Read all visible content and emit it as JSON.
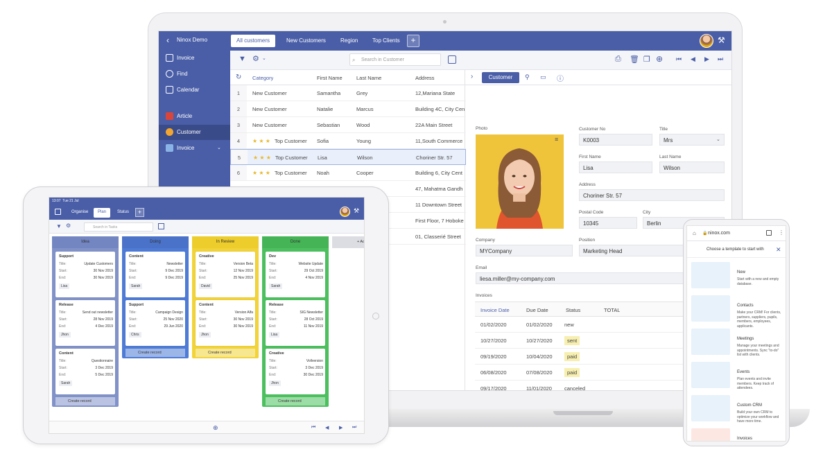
{
  "laptop": {
    "app_name": "Ninox Demo",
    "tabs": [
      "All customers",
      "New Customers",
      "Region",
      "Top Clients"
    ],
    "tab_plus": "+",
    "sidebar": [
      {
        "label": "Invoice",
        "icon": "grid-icon"
      },
      {
        "label": "Find",
        "icon": "search-icon"
      },
      {
        "label": "Calendar",
        "icon": "calendar-icon"
      },
      {
        "label": "Article",
        "icon": "gift-icon"
      },
      {
        "label": "Customer",
        "icon": "people-icon"
      },
      {
        "label": "Invoice",
        "icon": "invoice-icon"
      }
    ],
    "search_placeholder": "Search in Customer",
    "columns": [
      "Category",
      "First Name",
      "Last Name",
      "Address"
    ],
    "rows": [
      {
        "n": "1",
        "stars": "",
        "category": "New Customer",
        "first": "Samantha",
        "last": "Grey",
        "address": "12,Mariana State"
      },
      {
        "n": "2",
        "stars": "",
        "category": "New Customer",
        "first": "Natalie",
        "last": "Marcus",
        "address": "Building 4C, City Cen"
      },
      {
        "n": "3",
        "stars": "",
        "category": "New Customer",
        "first": "Sebastian",
        "last": "Wood",
        "address": "22A Main Street"
      },
      {
        "n": "4",
        "stars": "★ ★ ★",
        "category": "Top Customer",
        "first": "Sofia",
        "last": "Young",
        "address": "11,South Commerce"
      },
      {
        "n": "5",
        "stars": "★ ★ ★",
        "category": "Top Customer",
        "first": "Lisa",
        "last": "Wilson",
        "address": "Choriner Str. 57"
      },
      {
        "n": "6",
        "stars": "★ ★ ★",
        "category": "Top Customer",
        "first": "Noah",
        "last": "Cooper",
        "address": "Building 6, City Cent"
      }
    ],
    "extra_addresses": [
      "47, Mahatma Gandh",
      "11 Downtown Street",
      "First Floor, 7 Hoboke",
      "01, Classerié Street"
    ],
    "detail": {
      "tab": "Customer",
      "photo_label": "Photo",
      "customer_no_label": "Customer No",
      "customer_no": "K0003",
      "title_label": "Title",
      "title": "Mrs",
      "first_name_label": "First Name",
      "first_name": "Lisa",
      "last_name_label": "Last Name",
      "last_name": "Wilson",
      "address_label": "Address",
      "address": "Choriner Str. 57",
      "postal_label": "Postal Code",
      "postal": "10345",
      "city_label": "City",
      "city": "Berlin",
      "company_label": "Company",
      "company": "MYCompany",
      "position_label": "Position",
      "position": "Marketing Head",
      "email_label": "Email",
      "email": "liesa.miller@my-company.com",
      "invoices_label": "Invoices",
      "inv_columns": [
        "Invoice Date",
        "Due Date",
        "Status",
        "TOTAL"
      ],
      "invoices": [
        {
          "date": "01/02/2020",
          "due": "01/02/2020",
          "status": "new",
          "badge": ""
        },
        {
          "date": "10/27/2020",
          "due": "10/27/2020",
          "status": "sent",
          "badge": "#f7efb0"
        },
        {
          "date": "09/19/2020",
          "due": "10/04/2020",
          "status": "paid",
          "badge": "#f7efb0"
        },
        {
          "date": "06/08/2020",
          "due": "07/08/2020",
          "status": "paid",
          "badge": "#f7efb0"
        },
        {
          "date": "09/17/2020",
          "due": "11/01/2020",
          "status": "canceled",
          "badge": ""
        }
      ]
    }
  },
  "tablet": {
    "status_time": "13:07",
    "status_date": "Tue 21 Jul",
    "tabs": [
      "Organise",
      "Plan",
      "Status"
    ],
    "tab_plus": "+",
    "search_placeholder": "Search in Tasks",
    "columns": [
      {
        "name": "Idea",
        "color": "#8192c8",
        "head": "#7386c2",
        "cards": [
          {
            "type": "Support",
            "title": "Update Customers",
            "start": "30 Nov 2019",
            "end": "30 Nov 2019",
            "who": "Lisa"
          },
          {
            "type": "Release",
            "title": "Send out newsletter",
            "start": "28 Nov 2019",
            "end": "4 Dec 2019",
            "who": "Jhon"
          },
          {
            "type": "Content",
            "title": "Questionnaire",
            "start": "3 Dec 2019",
            "end": "5 Dec 2019",
            "who": "Sarah"
          }
        ],
        "create": "Create record"
      },
      {
        "name": "Doing",
        "color": "#4e7bd6",
        "head": "#4a72c8",
        "cards": [
          {
            "type": "Content",
            "title": "Newsletter",
            "start": "9 Dec 2019",
            "end": "9 Dec 2019",
            "who": "Sarah"
          },
          {
            "type": "Support",
            "title": "Campaign Design",
            "start": "25 Nov 2020",
            "end": "29 Jun 2020",
            "who": "Chris"
          }
        ],
        "create": "Create record"
      },
      {
        "name": "In Review",
        "color": "#f2d338",
        "head": "#edcd2c",
        "cards": [
          {
            "type": "Creative",
            "title": "Version Beta",
            "start": "12 Nov 2019",
            "end": "25 Nov 2019",
            "who": "David"
          },
          {
            "type": "Content",
            "title": "Version Alfa",
            "start": "30 Nov 2019",
            "end": "30 Nov 2019",
            "who": "Jhon"
          }
        ],
        "create": "Create record"
      },
      {
        "name": "Done",
        "color": "#4cc05e",
        "head": "#45b456",
        "cards": [
          {
            "type": "Dev",
            "title": "Website Update",
            "start": "29 Oct 2019",
            "end": "4 Nov 2019",
            "who": "Sarah"
          },
          {
            "type": "Release",
            "title": "SIG Newsletter",
            "start": "28 Oct 2019",
            "end": "11 Nov 2019",
            "who": "Lisa"
          },
          {
            "type": "Creative",
            "title": "Vollversion",
            "start": "3 Dec 2019",
            "end": "30 Dec 2019",
            "who": "Jhon"
          }
        ],
        "create": "Create record"
      }
    ],
    "add_column": "+ Ad",
    "card_labels": {
      "title": "Title:",
      "start": "Start:",
      "end": "End:"
    }
  },
  "phone": {
    "url": "ninox.com",
    "header": "Choose a template to start with",
    "templates": [
      {
        "title": "New",
        "desc": "Start with a new and empty database."
      },
      {
        "title": "Contacts",
        "desc": "Make your CRM! For clients, partners, suppliers, pupils, members, employees, applicants."
      },
      {
        "title": "Meetings",
        "desc": "Manage your meetings and appointments. Sync \"to-do\" list with clients."
      },
      {
        "title": "Events",
        "desc": "Plan events and invite members. Keep track of attendees."
      },
      {
        "title": "Custom CRM",
        "desc": "Build your own CRM to optimize your workflow and have more time."
      },
      {
        "title": "Invoices",
        "desc": ""
      }
    ]
  },
  "colors": {
    "brand": "#4a5ea8",
    "brand_dark": "#3a4b8a",
    "accent_star": "#e7b82b"
  }
}
